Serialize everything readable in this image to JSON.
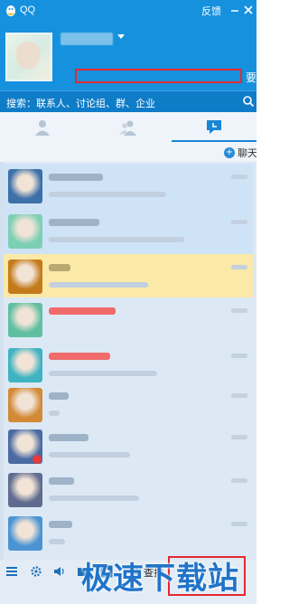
{
  "window": {
    "app_title": "QQ",
    "feedback_label": "反馈",
    "min_label": "—",
    "close_label": "✕"
  },
  "profile": {
    "side_char": "要"
  },
  "search": {
    "placeholder": "搜索：联系人、讨论组、群、企业"
  },
  "tabs": [
    {
      "name": "contacts",
      "icon": "person-icon"
    },
    {
      "name": "groups",
      "icon": "group-icon"
    },
    {
      "name": "chats",
      "icon": "chat-icon",
      "active": true
    }
  ],
  "session_bar": {
    "add_label": "聊天"
  },
  "sessions": [
    {
      "avatar_color": "#3d6fa8",
      "highlight": "#cfe3f7",
      "name_color": "#9eb2c8"
    },
    {
      "avatar_color": "#7dcfb4",
      "highlight": "#cfe3f7",
      "name_color": "#9eb2c8"
    },
    {
      "avatar_color": "#c47a1a",
      "highlight": "#fbe9a8",
      "name_color": "#b9a872"
    },
    {
      "avatar_color": "#5fbfa0",
      "highlight": "#dde8f5",
      "name_color": "#f06b6b"
    },
    {
      "avatar_color": "#3fb3c2",
      "highlight": "#dde8f5",
      "name_color": "#f06b6b"
    },
    {
      "avatar_color": "#d28a36",
      "highlight": "#dde8f5",
      "name_color": "#9eb2c8"
    },
    {
      "avatar_color": "#4a6aa2",
      "highlight": "#dde8f5",
      "name_color": "#9eb2c8",
      "badge": true
    },
    {
      "avatar_color": "#5f6b8f",
      "highlight": "#dde8f5",
      "name_color": "#9eb2c8"
    },
    {
      "avatar_color": "#4b94d4",
      "highlight": "#dde8f5",
      "name_color": "#9eb2c8"
    }
  ],
  "toolbar": {
    "find_label": "查找",
    "tools": [
      "menu-icon",
      "gear-icon",
      "speaker-icon",
      "folder-icon",
      "star-icon",
      "search-icon"
    ]
  },
  "watermark": {
    "text": "极速下载站"
  }
}
